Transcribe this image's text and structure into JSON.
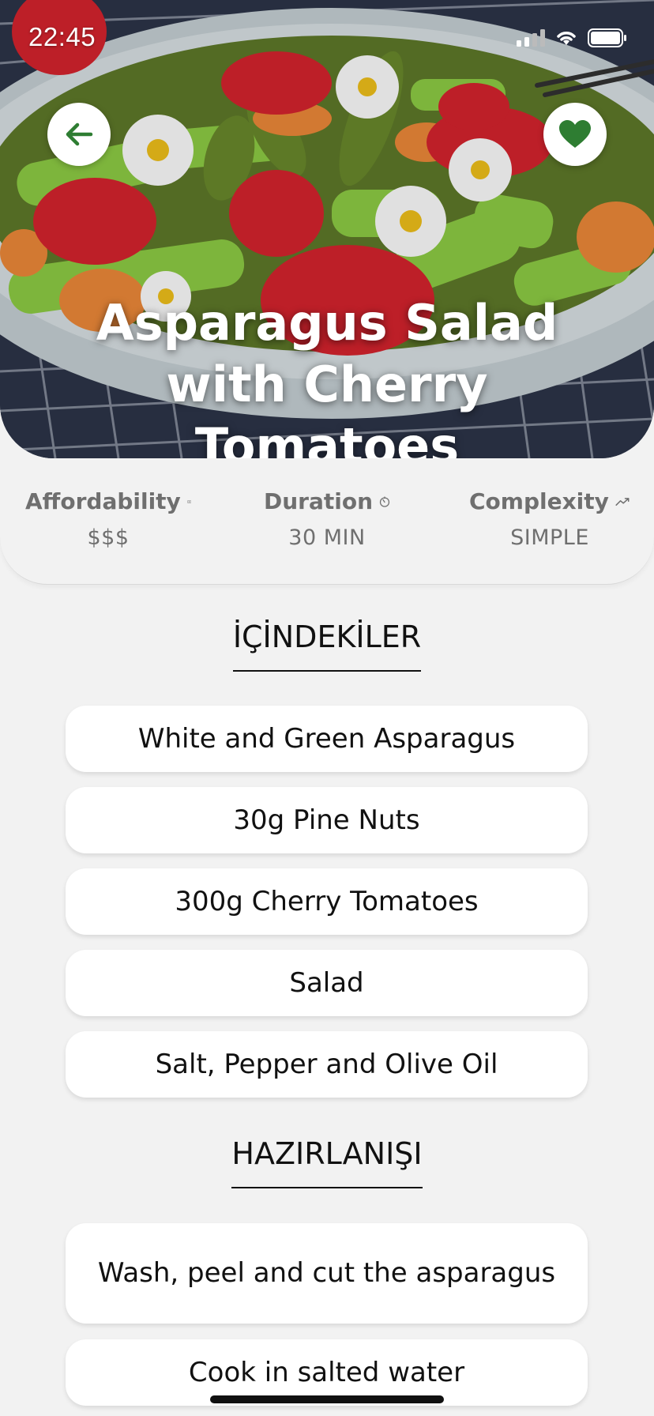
{
  "status_bar": {
    "time": "22:45"
  },
  "recipe": {
    "title": "Asparagus Salad with Cherry Tomatoes"
  },
  "meta": [
    {
      "label": "Affordability",
      "value": "$$$",
      "icon": "money-icon"
    },
    {
      "label": "Duration",
      "value": "30 MIN",
      "icon": "timer-icon"
    },
    {
      "label": "Complexity",
      "value": "SIMPLE",
      "icon": "trend-icon"
    }
  ],
  "ingredients": {
    "heading": "İÇİNDEKİLER",
    "items": [
      "White and Green Asparagus",
      "30g Pine Nuts",
      "300g Cherry Tomatoes",
      "Salad",
      "Salt, Pepper and Olive Oil"
    ]
  },
  "steps": {
    "heading": "HAZIRLANIŞI",
    "items": [
      "Wash, peel and cut the asparagus",
      "Cook in salted water"
    ]
  },
  "colors": {
    "accent": "#2e7d32",
    "background": "#f2f2f2",
    "text": "#111111",
    "muted": "#6f6f6f"
  }
}
